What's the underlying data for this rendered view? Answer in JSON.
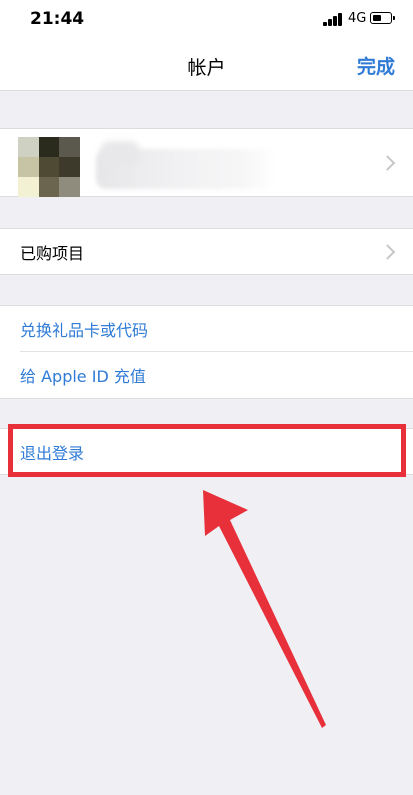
{
  "status_bar": {
    "time": "21:44",
    "network": "4G",
    "battery_level": 0.45,
    "signal_icon": "cellular-signal-icon",
    "battery_icon": "battery-icon"
  },
  "nav": {
    "title": "帐户",
    "done_label": "完成"
  },
  "profile": {
    "avatar_colors": [
      "#cfd1c2",
      "#2a2a1d",
      "#5b584d",
      "#c7c4a6",
      "#4e4a33",
      "#3d3a2c",
      "#f3f1d4",
      "#6b6550",
      "#8f8b7d"
    ]
  },
  "rows": {
    "purchased": "已购项目",
    "redeem": "兑换礼品卡或代码",
    "add_funds": "给 Apple ID 充值",
    "sign_out": "退出登录"
  },
  "colors": {
    "link_blue": "#2f7bd6",
    "annotation_red": "#e8303a",
    "background": "#efeff4"
  }
}
